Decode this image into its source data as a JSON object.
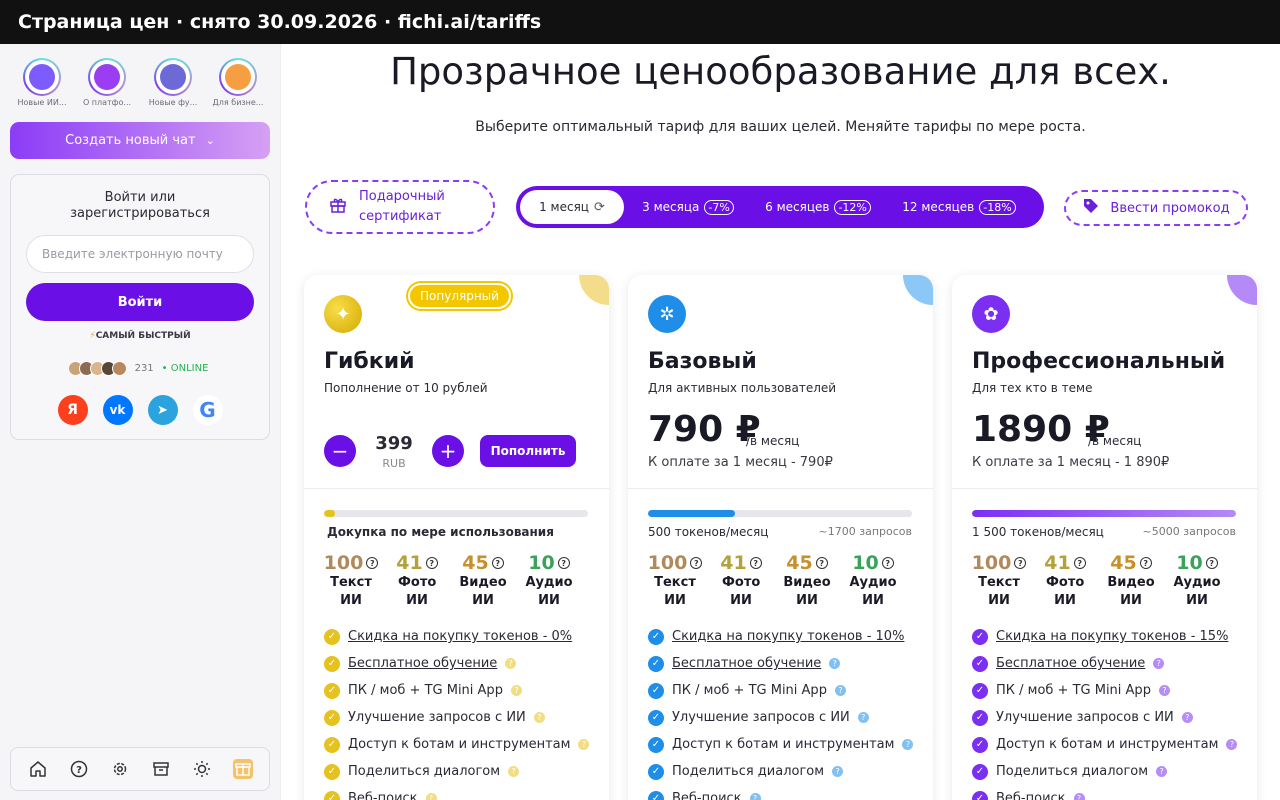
{
  "topbar": {
    "title": "Страница цен · снято 30.09.2026 · fichi.ai/tariffs"
  },
  "sidebar": {
    "stories": [
      {
        "label": "Новые ИИ...",
        "color": "#7c5cff"
      },
      {
        "label": "О платфо...",
        "color": "#9b3df2"
      },
      {
        "label": "Новые фу...",
        "color": "#6d6ad8"
      },
      {
        "label": "Для бизне...",
        "color": "#f59e42"
      }
    ],
    "new_chat_label": "Создать новый чат",
    "login": {
      "title": "Войти или зарегистрироваться",
      "email_placeholder": "Введите электронную почту",
      "enter_label": "Войти",
      "fastest_label": "САМЫЙ БЫСТРЫЙ",
      "online_count": "231",
      "online_label": "• ONLINE",
      "socials": [
        {
          "name": "yandex",
          "glyph": "Я",
          "color": "#fc3f1d"
        },
        {
          "name": "vk",
          "glyph": "vk",
          "color": "#0077ff"
        },
        {
          "name": "telegram",
          "glyph": "➤",
          "color": "#2aa3df"
        },
        {
          "name": "google",
          "glyph": "G",
          "color": "#ffffff"
        }
      ]
    },
    "bottom_icons": [
      "home-icon",
      "help-icon",
      "settings-icon",
      "archive-icon",
      "theme-icon",
      "gift-icon"
    ]
  },
  "main": {
    "title": "Прозрачное ценообразование для всех.",
    "subtitle": "Выберите оптимальный тариф для ваших целей. Меняйте тарифы по мере роста.",
    "gift_label": "Подарочный сертификат",
    "periods": [
      {
        "label": "1 месяц",
        "discount": "",
        "active": true
      },
      {
        "label": "3 месяца",
        "discount": "-7%",
        "active": false
      },
      {
        "label": "6 месяцев",
        "discount": "-12%",
        "active": false
      },
      {
        "label": "12 месяцев",
        "discount": "-18%",
        "active": false
      }
    ],
    "promo_label": "Ввести промокод",
    "plans": [
      {
        "name": "Гибкий",
        "desc": "Пополнение от 10 рублей",
        "badge": "Популярный",
        "accent": "#e6c21f",
        "corner": "#f3dd8a",
        "stepper_value": "399",
        "stepper_currency": "RUB",
        "topup_label": "Пополнить",
        "bar_fill": 0.04,
        "tokens_label": "Докупка по мере использования",
        "requests_label": "",
        "counts": [
          {
            "value": "100",
            "label": "Текст ИИ",
            "color": "#b08a5b"
          },
          {
            "value": "41",
            "label": "Фото ИИ",
            "color": "#b3a23b"
          },
          {
            "value": "45",
            "label": "Видео ИИ",
            "color": "#c6902c"
          },
          {
            "value": "10",
            "label": "Аудио ИИ",
            "color": "#3aa35a"
          }
        ],
        "features": [
          {
            "text": "Скидка на покупку токенов - 0%",
            "underline": true,
            "help": false
          },
          {
            "text": "Бесплатное обучение",
            "underline": true,
            "help": true
          },
          {
            "text": "ПК / моб + TG Mini App",
            "underline": false,
            "help": true
          },
          {
            "text": "Улучшение запросов с ИИ",
            "underline": false,
            "help": true
          },
          {
            "text": "Доступ к ботам и инструментам",
            "underline": false,
            "help": true
          },
          {
            "text": "Поделиться диалогом",
            "underline": false,
            "help": true
          },
          {
            "text": "Веб-поиск",
            "underline": false,
            "help": true
          }
        ]
      },
      {
        "name": "Базовый",
        "desc": "Для активных пользователей",
        "accent": "#1e8ee8",
        "corner": "#8cc8f7",
        "price": "790 ₽",
        "per_month": "/в месяц",
        "pay_line": "К оплате за 1 месяц - 790₽",
        "bar_fill": 0.33,
        "tokens_label": "500 токенов/месяц",
        "requests_label": "~1700 запросов",
        "counts": [
          {
            "value": "100",
            "label": "Текст ИИ",
            "color": "#b08a5b"
          },
          {
            "value": "41",
            "label": "Фото ИИ",
            "color": "#b3a23b"
          },
          {
            "value": "45",
            "label": "Видео ИИ",
            "color": "#c6902c"
          },
          {
            "value": "10",
            "label": "Аудио ИИ",
            "color": "#3aa35a"
          }
        ],
        "features": [
          {
            "text": "Скидка на покупку токенов - 10%",
            "underline": true,
            "help": false
          },
          {
            "text": "Бесплатное обучение",
            "underline": true,
            "help": true
          },
          {
            "text": "ПК / моб + TG Mini App",
            "underline": false,
            "help": true
          },
          {
            "text": "Улучшение запросов с ИИ",
            "underline": false,
            "help": true
          },
          {
            "text": "Доступ к ботам и инструментам",
            "underline": false,
            "help": true
          },
          {
            "text": "Поделиться диалогом",
            "underline": false,
            "help": true
          },
          {
            "text": "Веб-поиск",
            "underline": false,
            "help": true
          }
        ]
      },
      {
        "name": "Профессиональный",
        "desc": "Для тех кто в теме",
        "accent": "#7b2ff2",
        "corner": "#b58af7",
        "price": "1890 ₽",
        "per_month": "/в месяц",
        "pay_line": "К оплате за 1 месяц - 1 890₽",
        "bar_fill": 1.0,
        "tokens_label": "1 500 токенов/месяц",
        "requests_label": "~5000 запросов",
        "counts": [
          {
            "value": "100",
            "label": "Текст ИИ",
            "color": "#b08a5b"
          },
          {
            "value": "41",
            "label": "Фото ИИ",
            "color": "#b3a23b"
          },
          {
            "value": "45",
            "label": "Видео ИИ",
            "color": "#c6902c"
          },
          {
            "value": "10",
            "label": "Аудио ИИ",
            "color": "#3aa35a"
          }
        ],
        "features": [
          {
            "text": "Скидка на покупку токенов - 15%",
            "underline": true,
            "help": false
          },
          {
            "text": "Бесплатное обучение",
            "underline": true,
            "help": true
          },
          {
            "text": "ПК / моб + TG Mini App",
            "underline": false,
            "help": true
          },
          {
            "text": "Улучшение запросов с ИИ",
            "underline": false,
            "help": true
          },
          {
            "text": "Доступ к ботам и инструментам",
            "underline": false,
            "help": true
          },
          {
            "text": "Поделиться диалогом",
            "underline": false,
            "help": true
          },
          {
            "text": "Веб-поиск",
            "underline": false,
            "help": true
          }
        ]
      }
    ]
  }
}
